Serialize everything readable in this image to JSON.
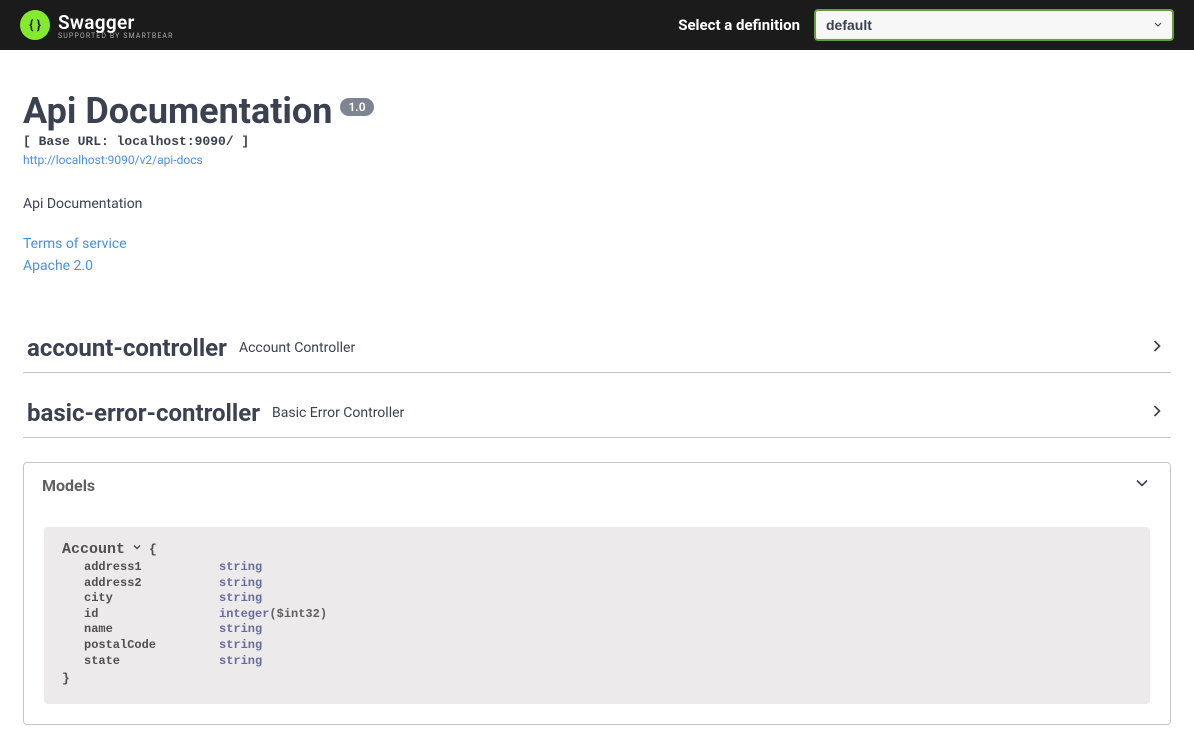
{
  "topbar": {
    "logo_title": "Swagger",
    "logo_sub": "Supported by SMARTBEAR",
    "select_label": "Select a definition",
    "select_value": "default"
  },
  "header": {
    "title": "Api Documentation",
    "version": "1.0",
    "base_url": "[ Base URL: localhost:9090/ ]",
    "docs_url": "http://localhost:9090/v2/api-docs",
    "description": "Api Documentation",
    "terms_link": "Terms of service",
    "license_link": "Apache 2.0"
  },
  "tags": [
    {
      "name": "account-controller",
      "desc": "Account Controller"
    },
    {
      "name": "basic-error-controller",
      "desc": "Basic Error Controller"
    }
  ],
  "models": {
    "title": "Models",
    "items": [
      {
        "name": "Account",
        "props": [
          {
            "key": "address1",
            "type": "string",
            "fmt": ""
          },
          {
            "key": "address2",
            "type": "string",
            "fmt": ""
          },
          {
            "key": "city",
            "type": "string",
            "fmt": ""
          },
          {
            "key": "id",
            "type": "integer",
            "fmt": "($int32)"
          },
          {
            "key": "name",
            "type": "string",
            "fmt": ""
          },
          {
            "key": "postalCode",
            "type": "string",
            "fmt": ""
          },
          {
            "key": "state",
            "type": "string",
            "fmt": ""
          }
        ]
      }
    ]
  }
}
